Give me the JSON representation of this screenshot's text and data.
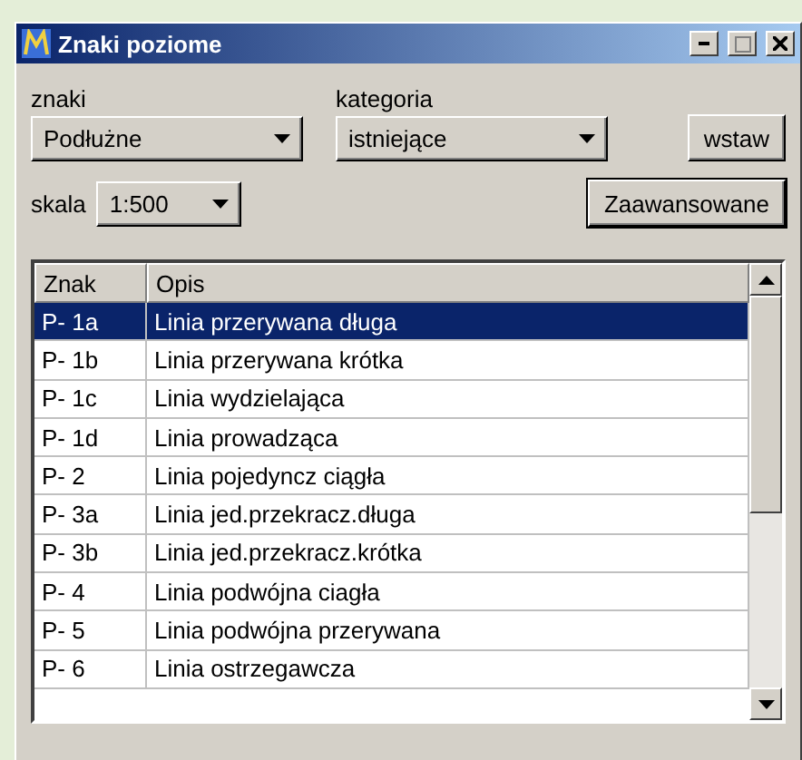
{
  "window": {
    "title": "Znaki poziome"
  },
  "fields": [
    {
      "label": "znaki",
      "value": "Podłużne"
    },
    {
      "label": "kategoria",
      "value": "istniejące"
    }
  ],
  "insert_button": "wstaw",
  "scale": {
    "label": "skala",
    "value": "1:500"
  },
  "advanced_button": "Zaawansowane",
  "table": {
    "columns": [
      "Znak",
      "Opis"
    ],
    "rows": [
      {
        "code": "P- 1a",
        "description": "Linia przerywana długa",
        "selected": true
      },
      {
        "code": "P- 1b",
        "description": "Linia przerywana krótka",
        "selected": false
      },
      {
        "code": "P- 1c",
        "description": "Linia wydzielająca",
        "selected": false
      },
      {
        "code": "P- 1d",
        "description": "Linia prowadząca",
        "selected": false
      },
      {
        "code": "P- 2",
        "description": "Linia pojedyncz ciągła",
        "selected": false
      },
      {
        "code": "P- 3a",
        "description": "Linia jed.przekracz.długa",
        "selected": false
      },
      {
        "code": "P- 3b",
        "description": "Linia jed.przekracz.krótka",
        "selected": false
      },
      {
        "code": "P- 4",
        "description": "Linia podwójna ciagła",
        "selected": false
      },
      {
        "code": "P- 5",
        "description": "Linia podwójna przerywana",
        "selected": false
      },
      {
        "code": "P- 6",
        "description": "Linia ostrzegawcza",
        "selected": false
      }
    ]
  }
}
